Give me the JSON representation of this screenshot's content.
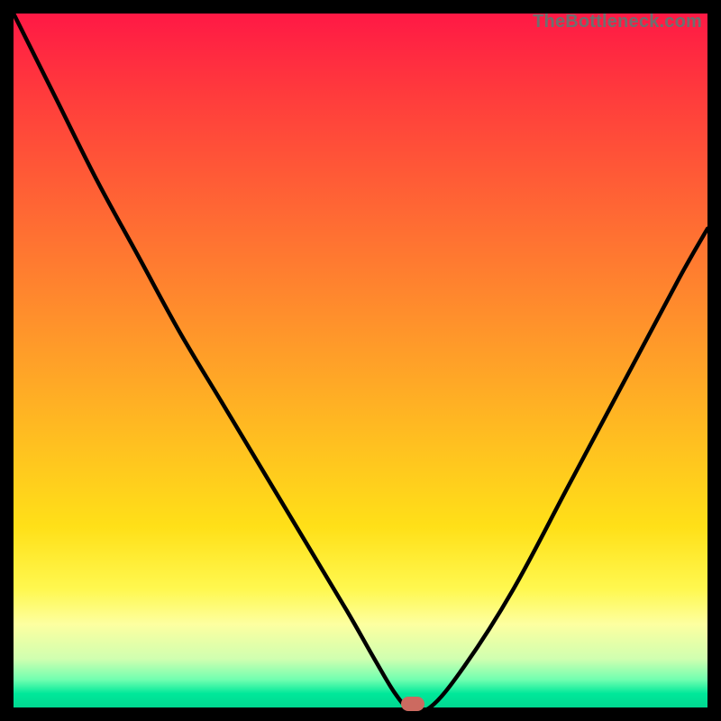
{
  "watermark": {
    "text": "TheBottleneck.com"
  },
  "colors": {
    "frame_bg": "#000000",
    "marker": "#cc6a60",
    "curve": "#000000",
    "gradient_top": "#ff1945",
    "gradient_bottom": "#00d890"
  },
  "chart_data": {
    "type": "line",
    "title": "",
    "xlabel": "",
    "ylabel": "",
    "xlim": [
      0,
      100
    ],
    "ylim": [
      0,
      100
    ],
    "grid": false,
    "legend": false,
    "annotations": [
      {
        "name": "minimum-marker",
        "x": 57.5,
        "y": 0.5
      }
    ],
    "series": [
      {
        "name": "bottleneck-curve",
        "x": [
          0,
          6,
          12,
          18,
          24,
          30,
          36,
          42,
          48,
          52,
          55,
          57,
          60,
          65,
          72,
          80,
          88,
          96,
          100
        ],
        "y": [
          100,
          88,
          76,
          65,
          54,
          44,
          34,
          24,
          14,
          7,
          2,
          0,
          0,
          6,
          17,
          32,
          47,
          62,
          69
        ]
      }
    ]
  }
}
